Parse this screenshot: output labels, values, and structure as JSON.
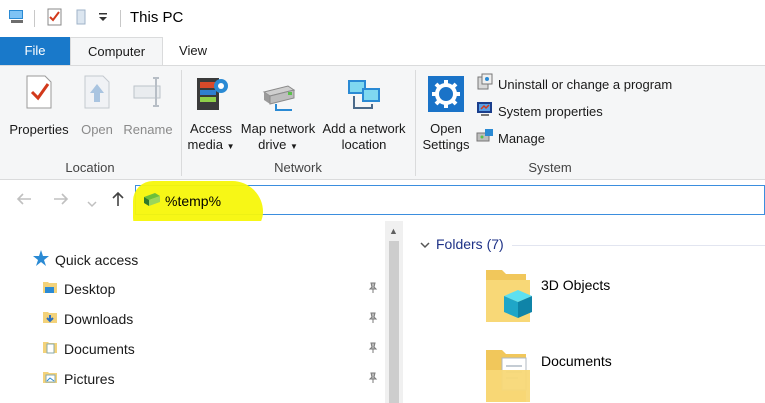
{
  "window": {
    "title": "This PC"
  },
  "tabs": {
    "file": "File",
    "computer": "Computer",
    "view": "View"
  },
  "ribbon": {
    "location": {
      "label": "Location",
      "properties": "Properties",
      "open": "Open",
      "rename": "Rename"
    },
    "network": {
      "label": "Network",
      "access_media_1": "Access",
      "access_media_2": "media",
      "map_drive_1": "Map network",
      "map_drive_2": "drive",
      "add_location_1": "Add a network",
      "add_location_2": "location"
    },
    "system": {
      "label": "System",
      "open_settings_1": "Open",
      "open_settings_2": "Settings",
      "uninstall": "Uninstall or change a program",
      "system_properties": "System properties",
      "manage": "Manage"
    }
  },
  "address": {
    "value": "%temp%"
  },
  "navpane": {
    "quick_access": "Quick access",
    "items": [
      {
        "label": "Desktop"
      },
      {
        "label": "Downloads"
      },
      {
        "label": "Documents"
      },
      {
        "label": "Pictures"
      }
    ]
  },
  "content": {
    "section": "Folders (7)",
    "folders": [
      {
        "label": "3D Objects"
      },
      {
        "label": "Documents"
      }
    ]
  },
  "colors": {
    "accent": "#1979ca",
    "highlight": "#f7f70a",
    "section_text": "#1e3287"
  }
}
